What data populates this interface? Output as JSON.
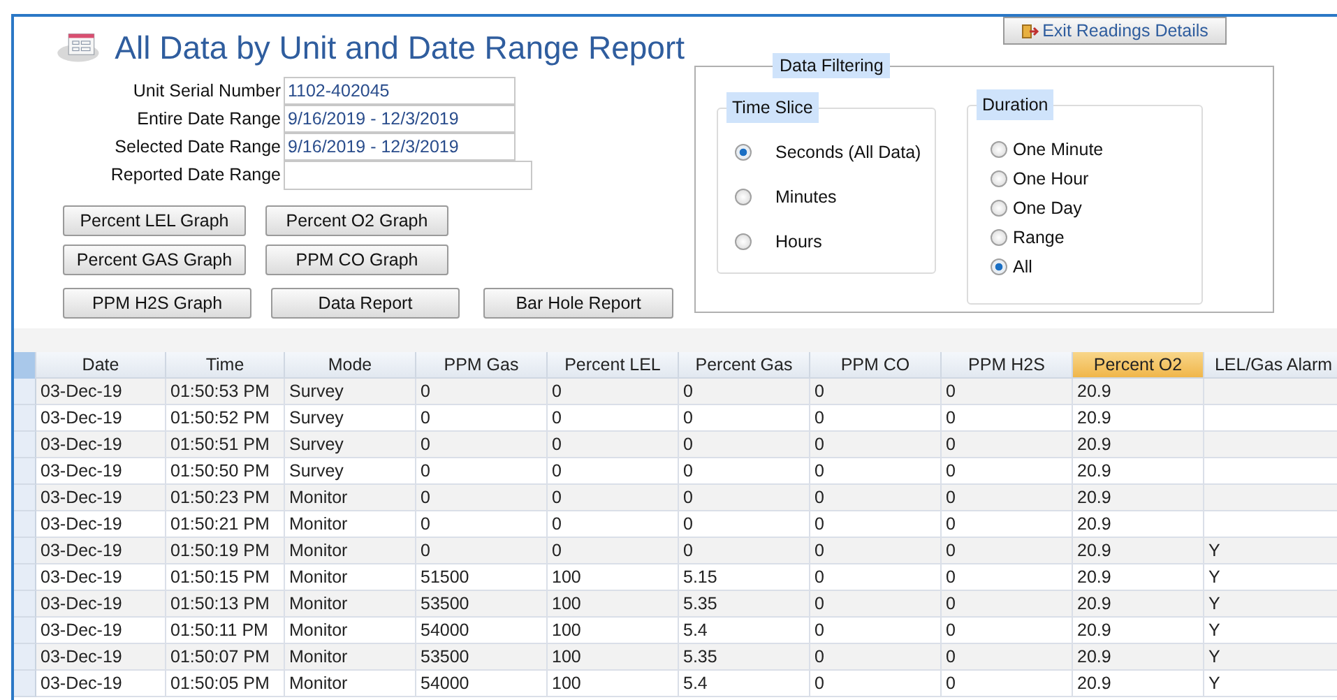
{
  "title": "All Data by Unit and Date Range Report",
  "exit_button": "Exit Readings Details",
  "fields": [
    {
      "label": "Unit Serial Number",
      "value": "1102-402045"
    },
    {
      "label": "Entire Date Range",
      "value": "9/16/2019 - 12/3/2019"
    },
    {
      "label": "Selected Date Range",
      "value": "9/16/2019 - 12/3/2019"
    },
    {
      "label": "Reported Date Range"
    }
  ],
  "buttons": [
    [
      "Percent LEL Graph",
      "Percent O2 Graph"
    ],
    [
      "Percent GAS Graph",
      "PPM CO Graph"
    ],
    [
      "PPM H2S Graph",
      "Data Report",
      "Bar Hole Report"
    ]
  ],
  "filtering": {
    "title": "Data Filtering",
    "time_slice": {
      "title": "Time Slice",
      "options": [
        {
          "label": "Seconds (All Data)",
          "selected": true
        },
        {
          "label": "Minutes",
          "selected": false
        },
        {
          "label": "Hours",
          "selected": false
        }
      ]
    },
    "duration": {
      "title": "Duration",
      "options": [
        {
          "label": "One Minute",
          "selected": false
        },
        {
          "label": "One Hour",
          "selected": false
        },
        {
          "label": "One Day",
          "selected": false
        },
        {
          "label": "Range",
          "selected": false
        },
        {
          "label": "All",
          "selected": true
        }
      ]
    }
  },
  "table": {
    "columns": [
      {
        "label": "Date",
        "selected": false
      },
      {
        "label": "Time",
        "selected": false
      },
      {
        "label": "Mode",
        "selected": false
      },
      {
        "label": "PPM Gas",
        "selected": false
      },
      {
        "label": "Percent LEL",
        "selected": false
      },
      {
        "label": "Percent Gas",
        "selected": false
      },
      {
        "label": "PPM CO",
        "selected": false
      },
      {
        "label": "PPM H2S",
        "selected": false
      },
      {
        "label": "Percent O2",
        "selected": true
      },
      {
        "label": "LEL/Gas Alarm",
        "selected": false
      }
    ],
    "rows": [
      [
        "03-Dec-19",
        "01:50:53 PM",
        "Survey",
        "0",
        "0",
        "0",
        "0",
        "0",
        "20.9",
        ""
      ],
      [
        "03-Dec-19",
        "01:50:52 PM",
        "Survey",
        "0",
        "0",
        "0",
        "0",
        "0",
        "20.9",
        ""
      ],
      [
        "03-Dec-19",
        "01:50:51 PM",
        "Survey",
        "0",
        "0",
        "0",
        "0",
        "0",
        "20.9",
        ""
      ],
      [
        "03-Dec-19",
        "01:50:50 PM",
        "Survey",
        "0",
        "0",
        "0",
        "0",
        "0",
        "20.9",
        ""
      ],
      [
        "03-Dec-19",
        "01:50:23 PM",
        "Monitor",
        "0",
        "0",
        "0",
        "0",
        "0",
        "20.9",
        ""
      ],
      [
        "03-Dec-19",
        "01:50:21 PM",
        "Monitor",
        "0",
        "0",
        "0",
        "0",
        "0",
        "20.9",
        ""
      ],
      [
        "03-Dec-19",
        "01:50:19 PM",
        "Monitor",
        "0",
        "0",
        "0",
        "0",
        "0",
        "20.9",
        "Y"
      ],
      [
        "03-Dec-19",
        "01:50:15 PM",
        "Monitor",
        "51500",
        "100",
        "5.15",
        "0",
        "0",
        "20.9",
        "Y"
      ],
      [
        "03-Dec-19",
        "01:50:13 PM",
        "Monitor",
        "53500",
        "100",
        "5.35",
        "0",
        "0",
        "20.9",
        "Y"
      ],
      [
        "03-Dec-19",
        "01:50:11 PM",
        "Monitor",
        "54000",
        "100",
        "5.4",
        "0",
        "0",
        "20.9",
        "Y"
      ],
      [
        "03-Dec-19",
        "01:50:07 PM",
        "Monitor",
        "53500",
        "100",
        "5.35",
        "0",
        "0",
        "20.9",
        "Y"
      ],
      [
        "03-Dec-19",
        "01:50:05 PM",
        "Monitor",
        "54000",
        "100",
        "5.4",
        "0",
        "0",
        "20.9",
        "Y"
      ]
    ]
  }
}
